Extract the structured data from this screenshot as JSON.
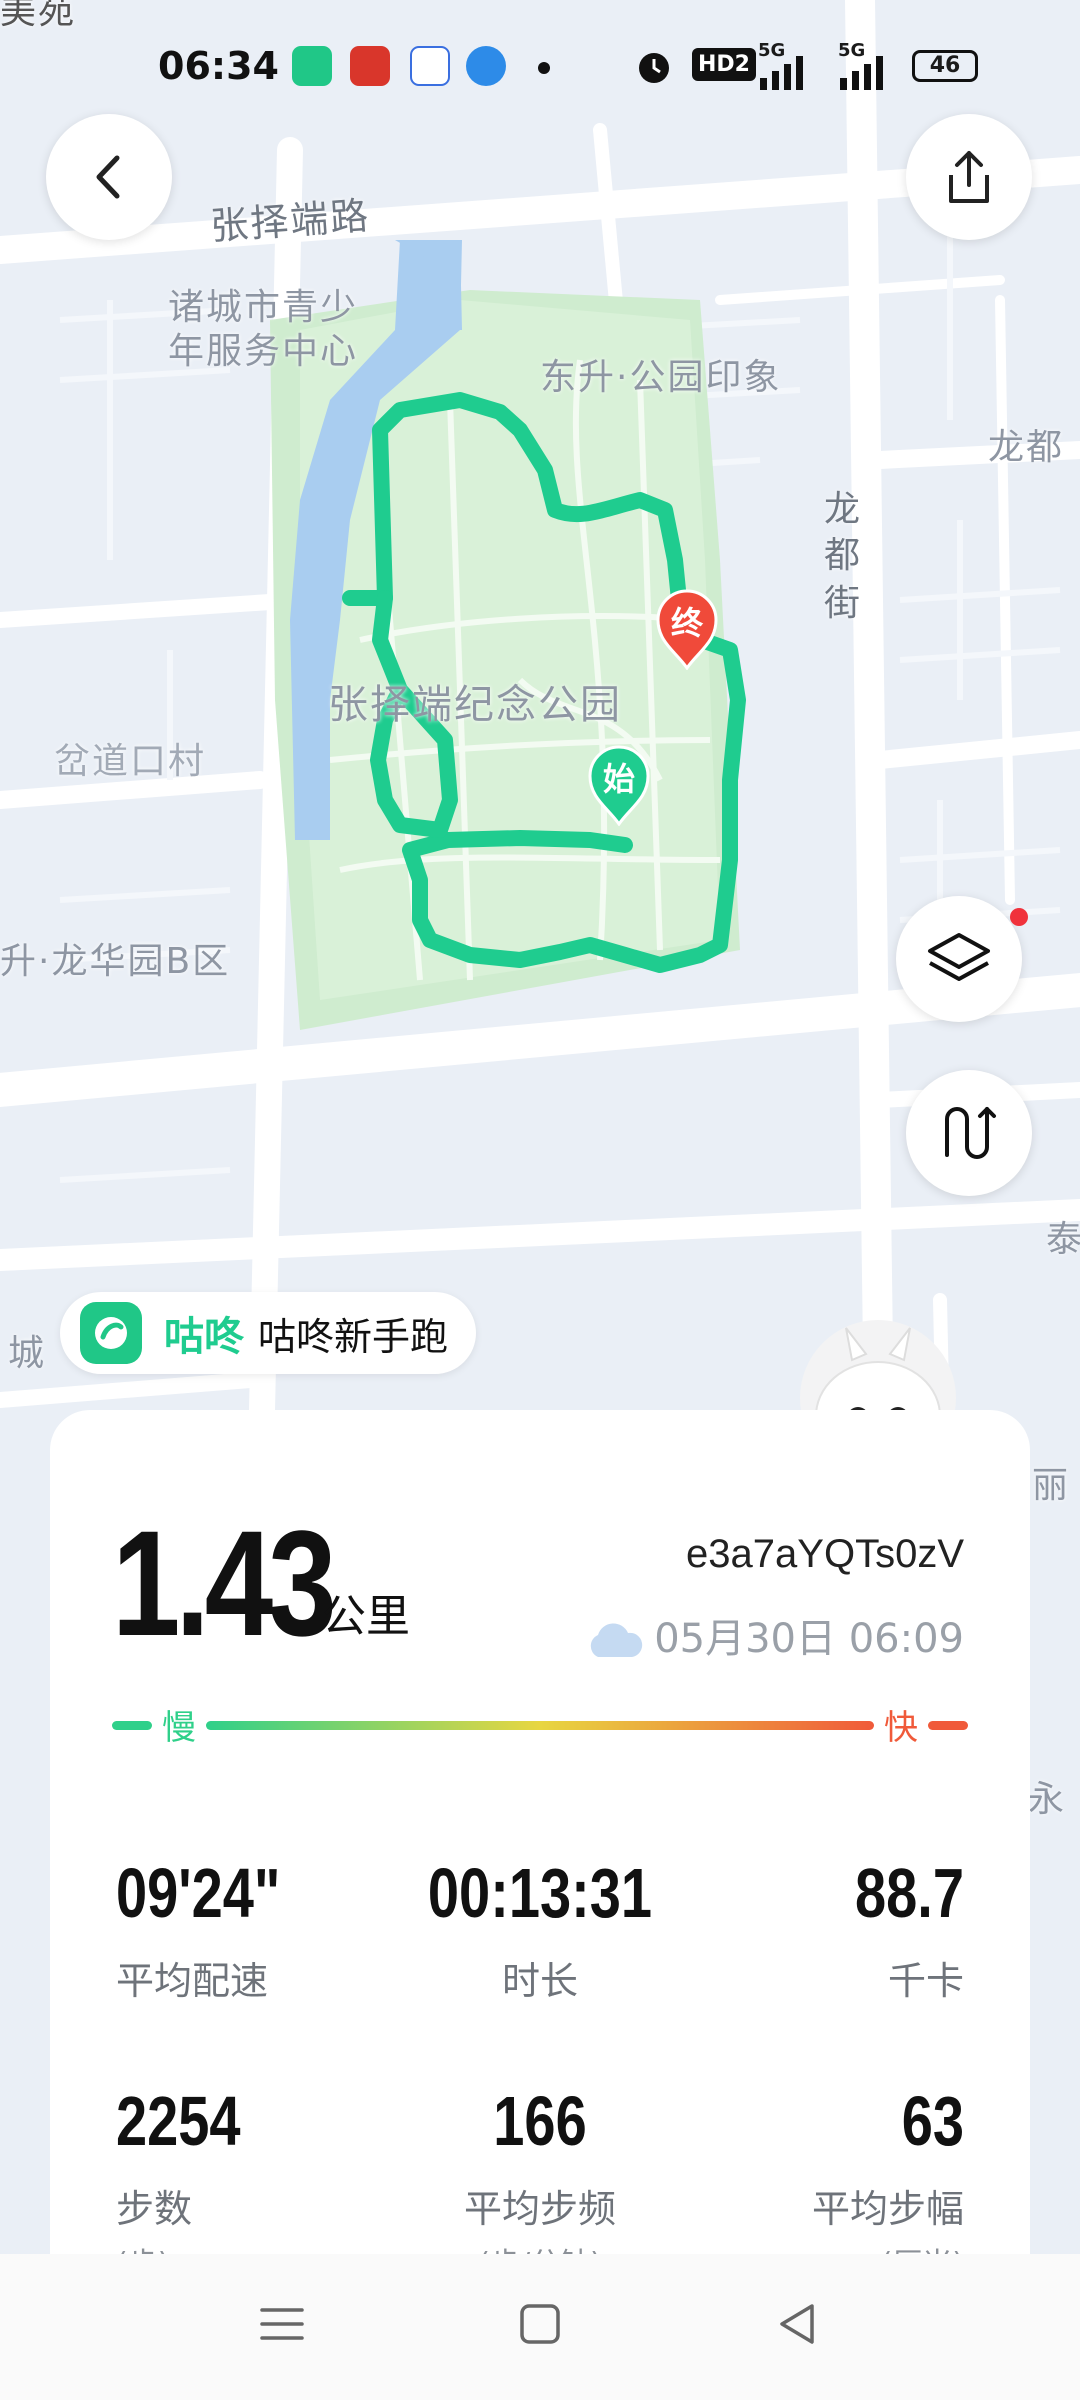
{
  "status_bar": {
    "time": "06:34",
    "network_1": "5G",
    "network_2": "5G",
    "hd": "HD2",
    "battery": "46"
  },
  "map": {
    "labels": {
      "road_north": "张择端路",
      "youth_center_1": "诸城市青少",
      "youth_center_2": "年服务中心",
      "dongsheng": "东升·公园印象",
      "longdu_right": "龙都",
      "longdu_street_1": "龙",
      "longdu_street_2": "都",
      "longdu_street_3": "街",
      "park": "张择端纪念公园",
      "village": "岔道口村",
      "longhua": "升·龙华园B区",
      "cheng": "城",
      "tai": "泰",
      "li": "丽",
      "yong": "永",
      "top_edge": "美苑"
    },
    "start_marker": "始",
    "end_marker": "终",
    "route_color": "#1fcc8f"
  },
  "brand": {
    "name": "咕咚",
    "run_label": "咕咚新手跑"
  },
  "summary": {
    "distance": "1.43",
    "distance_unit": "公里",
    "record_id": "e3a7aYQTs0zV",
    "datetime": "05月30日 06:09",
    "pace_slow": "慢",
    "pace_fast": "快"
  },
  "stats": [
    {
      "value": "09'24\"",
      "label": "平均配速",
      "unit": ""
    },
    {
      "value": "00:13:31",
      "label": "时长",
      "unit": ""
    },
    {
      "value": "88.7",
      "label": "千卡",
      "unit": ""
    },
    {
      "value": "2254",
      "label": "步数",
      "unit": "(步)"
    },
    {
      "value": "166",
      "label": "平均步频",
      "unit": "(步/分钟)"
    },
    {
      "value": "63",
      "label": "平均步幅",
      "unit": "(厘米)"
    }
  ],
  "colors": {
    "accent_green": "#1fcc8f",
    "end_red": "#f04a3a",
    "notification_dot": "#f0323c"
  }
}
